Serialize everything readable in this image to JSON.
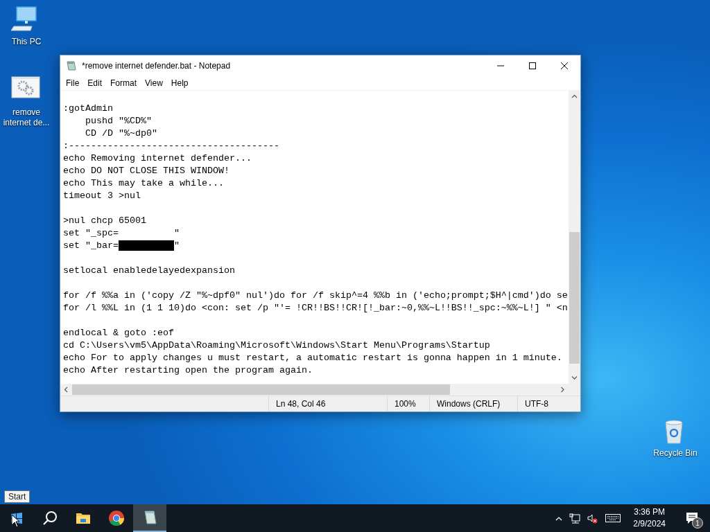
{
  "desktop_icons": [
    {
      "kind": "pc",
      "label": "This PC"
    },
    {
      "kind": "batch",
      "label": "remove internet de..."
    },
    {
      "kind": "bin",
      "label": "Recycle Bin"
    }
  ],
  "notepad": {
    "title": "*remove internet defender.bat - Notepad",
    "menu": [
      "File",
      "Edit",
      "Format",
      "View",
      "Help"
    ],
    "lines": [
      {
        "kind": "code",
        "text": ":gotAdmin"
      },
      {
        "kind": "code",
        "text": "    pushd \"%CD%\""
      },
      {
        "kind": "code",
        "text": "    CD /D \"%~dp0\""
      },
      {
        "kind": "code",
        "text": ":--------------------------------------"
      },
      {
        "kind": "code",
        "text": "echo Removing internet defender..."
      },
      {
        "kind": "code",
        "text": "echo DO NOT CLOSE THIS WINDOW!"
      },
      {
        "kind": "code",
        "text": "echo This may take a while..."
      },
      {
        "kind": "code",
        "text": "timeout 3 >nul"
      },
      {
        "kind": "blank"
      },
      {
        "kind": "code",
        "text": ">nul chcp 65001"
      },
      {
        "kind": "code",
        "text": "set \"_spc=          \""
      },
      {
        "kind": "code",
        "text": "set \"_bar=██████████\""
      },
      {
        "kind": "blank"
      },
      {
        "kind": "code",
        "text": "setlocal enabledelayedexpansion"
      },
      {
        "kind": "blank"
      },
      {
        "kind": "code",
        "text": "for /f %%a in ('copy /Z \"%~dpf0\" nul')do for /f skip^=4 %%b in ('echo;prompt;$H^|cmd')do se"
      },
      {
        "kind": "code",
        "text": "for /l %%L in (1 1 10)do <con: set /p \"'= !CR!!BS!!CR![!_bar:~0,%%~L!!BS!!_spc:~%%~L!] \" <n"
      },
      {
        "kind": "blank"
      },
      {
        "kind": "code",
        "text": "endlocal & goto :eof"
      },
      {
        "kind": "code",
        "text": "cd C:\\Users\\vm5\\AppData\\Roaming\\Microsoft\\Windows\\Start Menu\\Programs\\Startup"
      },
      {
        "kind": "code",
        "text": "echo For to apply changes u must restart, a automatic restart is gonna happen in 1 minute."
      },
      {
        "kind": "code",
        "text": "echo After restarting open the program again."
      }
    ],
    "status_bar": [
      "Ln 48, Col 46",
      "100%",
      "Windows (CRLF)",
      "UTF-8"
    ]
  },
  "tooltip": "Start",
  "taskbar": {
    "apps": [
      {
        "kind": "search",
        "selected": false
      },
      {
        "kind": "explorer",
        "selected": false
      },
      {
        "kind": "chrome",
        "selected": false
      },
      {
        "kind": "notepad",
        "selected": true
      }
    ],
    "time": "3:36 PM",
    "date": "2/9/2024",
    "notification_count": "1"
  }
}
